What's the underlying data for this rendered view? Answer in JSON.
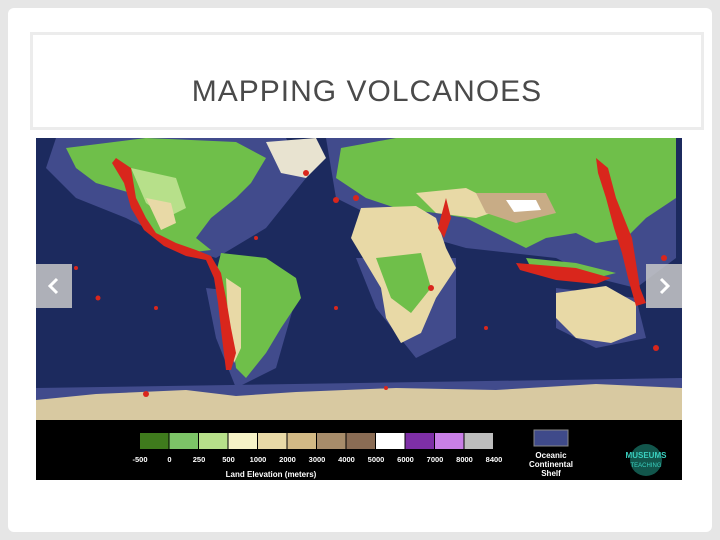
{
  "slide": {
    "title": "MAPPING VOLCANOES"
  },
  "navigation": {
    "prev_icon": "chevron-left-icon",
    "next_icon": "chevron-right-icon"
  },
  "legend": {
    "swatches": [
      {
        "label": "-500",
        "color": "#3f7b1d"
      },
      {
        "label": "0",
        "color": "#7cc467"
      },
      {
        "label": "250",
        "color": "#b7e08a"
      },
      {
        "label": "500",
        "color": "#f6f3c7"
      },
      {
        "label": "1000",
        "color": "#e8d9a6"
      },
      {
        "label": "2000",
        "color": "#d2b985"
      },
      {
        "label": "3000",
        "color": "#a78c6a"
      },
      {
        "label": "4000",
        "color": "#8a6c54"
      },
      {
        "label": "5000",
        "color": "#ffffff"
      },
      {
        "label": "6000",
        "color": "#7e2fa6"
      },
      {
        "label": "7000",
        "color": "#c97fe6"
      },
      {
        "label": "8000",
        "color": "#bdbdbd"
      },
      {
        "label": "8400",
        "color": "#bdbdbd"
      }
    ],
    "axis_label": "Land Elevation (meters)",
    "shelf_label_line1": "Oceanic",
    "shelf_label_line2": "Continental",
    "shelf_label_line3": "Shelf",
    "shelf_color": "#3f4a8a",
    "logo_text": "MUSEUMS IN TEACHING"
  },
  "colors": {
    "ocean": "#1c2a5e",
    "shelf": "#414b8c",
    "lowland": "#6fbf4a",
    "upland": "#b7e08a",
    "desert": "#e8d9a6",
    "highland": "#c8ac86",
    "ice": "#d8c9a1",
    "volcano": "#d9261c"
  }
}
